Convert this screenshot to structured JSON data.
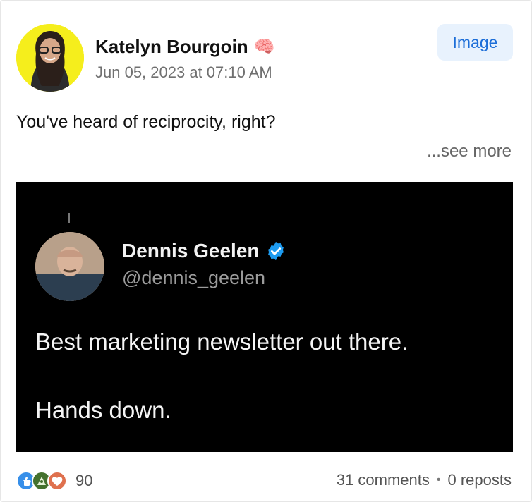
{
  "post": {
    "author_name": "Katelyn Bourgoin",
    "author_emoji_icon": "brain-icon",
    "timestamp": "Jun 05, 2023 at 07:10 AM",
    "type_badge": "Image",
    "text": "You've heard of reciprocity, right?",
    "see_more": "...see more"
  },
  "embedded_tweet": {
    "author_name": "Dennis Geelen",
    "handle": "@dennis_geelen",
    "line1": "Best marketing newsletter out there.",
    "line2": "Hands down.",
    "verified_icon": "verified-badge-icon"
  },
  "footer": {
    "reaction_count": "90",
    "comments": "31 comments",
    "separator": "•",
    "reposts": "0 reposts"
  },
  "colors": {
    "avatar_bg": "#f5ee1c",
    "badge_bg": "#e8f2fd",
    "badge_text": "#1c6ed8",
    "media_bg": "#000000",
    "verified": "#1d9bf0"
  }
}
